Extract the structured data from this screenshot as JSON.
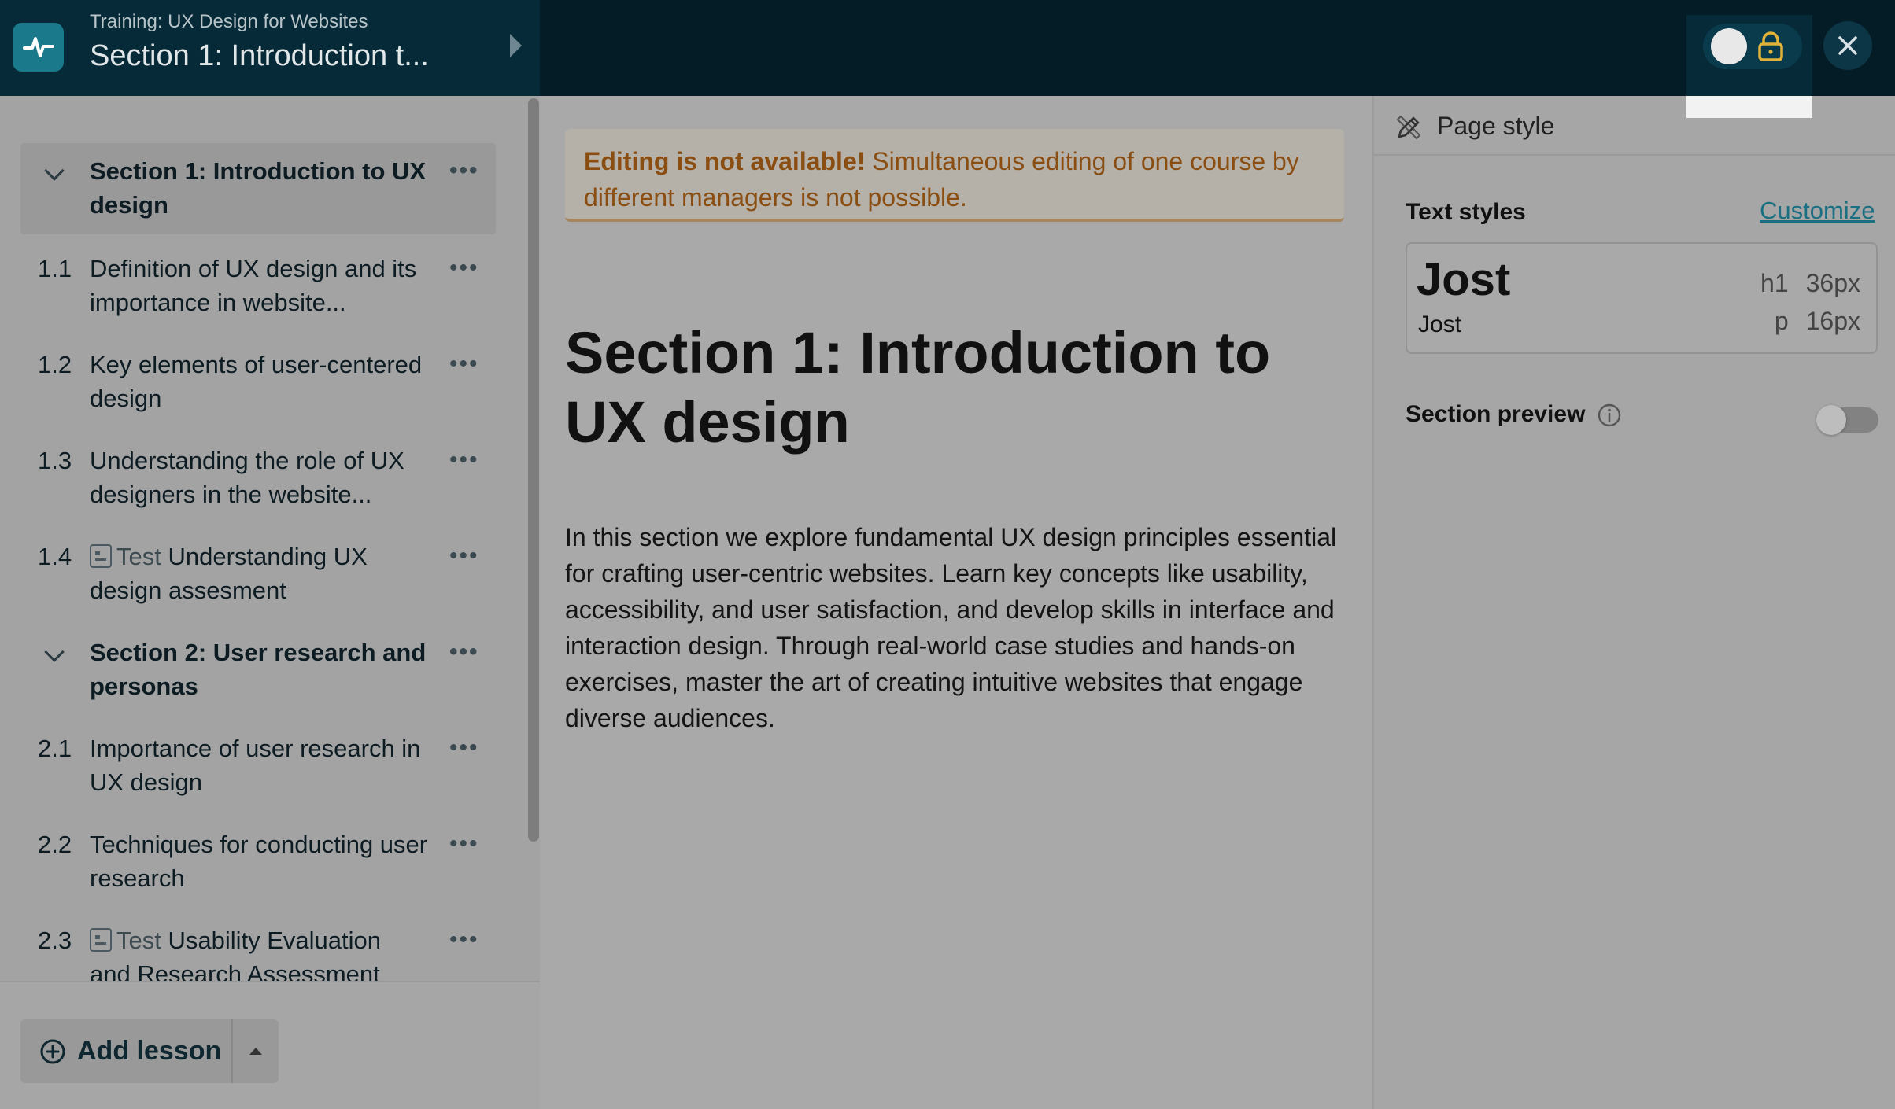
{
  "header": {
    "course_subtitle": "Training: UX Design for Websites",
    "course_title": "Section 1: Introduction t..."
  },
  "sidebar": {
    "items": [
      {
        "number": "",
        "label": "Section 1: Introduction to UX design",
        "type": "section"
      },
      {
        "number": "1.1",
        "label": "Definition of UX design and its importance in website...",
        "type": "lesson"
      },
      {
        "number": "1.2",
        "label": "Key elements of user-centered design",
        "type": "lesson"
      },
      {
        "number": "1.3",
        "label": "Understanding the role of UX designers in the website...",
        "type": "lesson"
      },
      {
        "number": "1.4",
        "test_tag": "Test",
        "label": "Understanding UX design assesment",
        "type": "test"
      },
      {
        "number": "",
        "label": "Section 2: User research and personas",
        "type": "section"
      },
      {
        "number": "2.1",
        "label": "Importance of user research in UX design",
        "type": "lesson"
      },
      {
        "number": "2.2",
        "label": "Techniques for conducting user research",
        "type": "lesson"
      },
      {
        "number": "2.3",
        "test_tag": "Test",
        "label": "Usability Evaluation and Research Assessment",
        "type": "test"
      }
    ],
    "more_glyph": "•••",
    "add_lesson_label": "Add lesson"
  },
  "main": {
    "alert_title": "Editing is not available!",
    "alert_text": "Simultaneous editing of one course by different managers is not possible.",
    "heading": "Section 1: Introduction to UX design",
    "body": "In this section we explore fundamental UX design principles essential for crafting user-centric websites. Learn key concepts like usability, accessibility, and user satisfaction, and develop skills in interface and interaction design. Through real-world case studies and hands-on exercises, master the art of creating intuitive websites that engage diverse audiences."
  },
  "panel": {
    "header_label": "Page style",
    "text_styles_label": "Text styles",
    "customize_label": "Customize",
    "h1_font": "Jost",
    "p_font": "Jost",
    "h1_tag": "h1",
    "h1_size": "36px",
    "p_tag": "p",
    "p_size": "16px",
    "section_preview_label": "Section preview",
    "section_preview_enabled": false
  },
  "colors": {
    "topbar": "#031c26",
    "logo": "#1a7a8c",
    "accent_link": "#1a6f82",
    "lock_icon": "#e0b23a",
    "alert_text": "#8a4e12"
  }
}
